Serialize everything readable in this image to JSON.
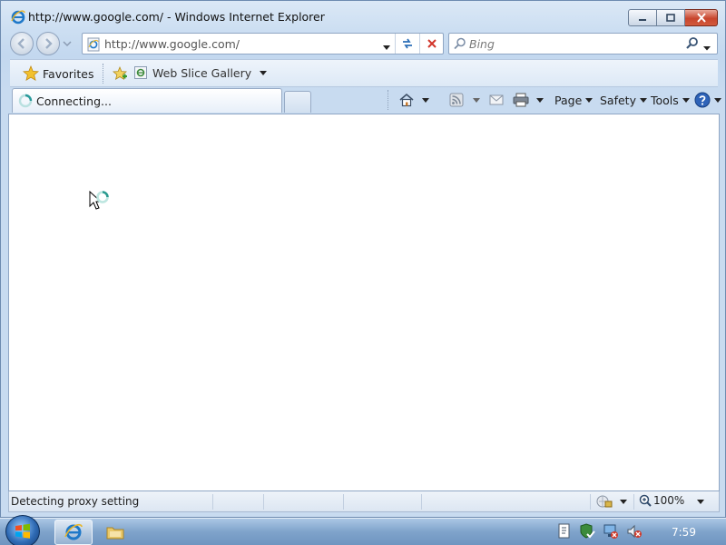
{
  "window": {
    "title": "http://www.google.com/ - Windows Internet Explorer"
  },
  "navigation": {
    "address_url": "http://www.google.com/",
    "search_placeholder": "Bing"
  },
  "favorites_bar": {
    "favorites_label": "Favorites",
    "web_slice_label": "Web Slice Gallery"
  },
  "tabs": [
    {
      "label": "Connecting..."
    }
  ],
  "command_bar": {
    "page_label": "Page",
    "safety_label": "Safety",
    "tools_label": "Tools"
  },
  "status_bar": {
    "status_text": "Detecting proxy setting",
    "zoom_label": "100%"
  },
  "taskbar": {
    "clock": "7:59"
  },
  "colors": {
    "window_frame": "#c3d8ef",
    "content_bg": "#ffffff",
    "close_button": "#c8452d",
    "taskbar": "#7fa3cb"
  },
  "icons": [
    "ie-icon",
    "back-icon",
    "forward-icon",
    "refresh-icon",
    "stop-icon",
    "search-icon",
    "star-icon",
    "add-favorite-icon",
    "web-slice-icon",
    "home-icon",
    "feeds-icon",
    "mail-icon",
    "print-icon",
    "help-icon",
    "busy-spinner-icon",
    "windows-logo-icon",
    "folder-icon",
    "zone-icon",
    "zoom-icon"
  ]
}
